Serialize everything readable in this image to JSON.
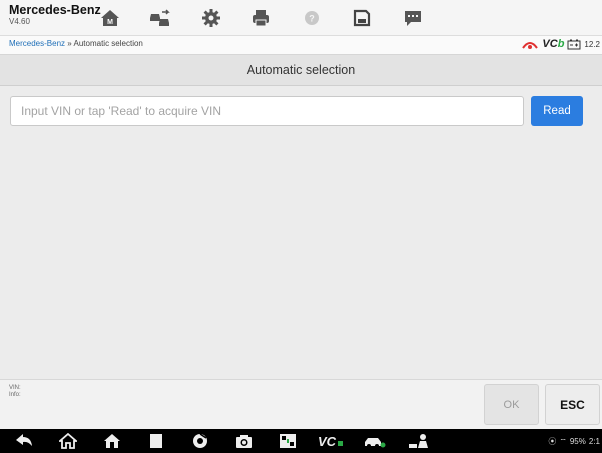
{
  "app": {
    "title": "Mercedes-Benz",
    "version": "V4.60"
  },
  "toolbar": {
    "buttons": [
      {
        "icon": "home-icon"
      },
      {
        "icon": "vehicle-swap-icon"
      },
      {
        "icon": "gear-icon"
      },
      {
        "icon": "printer-icon"
      },
      {
        "icon": "help-icon"
      },
      {
        "icon": "save-icon"
      },
      {
        "icon": "message-icon"
      }
    ]
  },
  "breadcrumb": {
    "root": "Mercedes-Benz",
    "separator": "»",
    "current": "Automatic selection"
  },
  "status": {
    "vci": "VC",
    "vci_accent": "b",
    "battery": "12.2"
  },
  "page": {
    "title": "Automatic selection"
  },
  "vin": {
    "placeholder": "Input VIN or tap 'Read' to acquire VIN",
    "value": ""
  },
  "buttons": {
    "read": "Read",
    "ok": "OK",
    "esc": "ESC"
  },
  "info": {
    "vin_label": "VIN:",
    "info_label": "Info:"
  },
  "system_tray": {
    "battery": "95%",
    "time": "2:1"
  },
  "colors": {
    "accent": "#2b7de0",
    "vci_green": "#2aa845",
    "signal_red": "#e03030"
  }
}
